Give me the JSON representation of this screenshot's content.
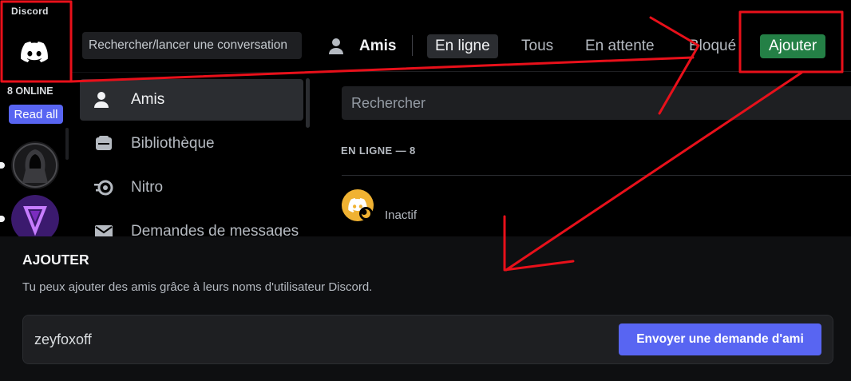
{
  "app": {
    "name": "Discord"
  },
  "rail": {
    "online_label": "8 ONLINE",
    "read_all_label": "Read all"
  },
  "dm": {
    "search_label": "Rechercher/lancer une conversation",
    "items": [
      {
        "label": "Amis",
        "icon": "friends-icon"
      },
      {
        "label": "Bibliothèque",
        "icon": "library-icon"
      },
      {
        "label": "Nitro",
        "icon": "nitro-icon"
      },
      {
        "label": "Demandes de messages",
        "icon": "mail-icon"
      }
    ]
  },
  "topbar": {
    "title": "Amis",
    "tabs": [
      {
        "label": "En ligne",
        "selected": true
      },
      {
        "label": "Tous",
        "selected": false
      },
      {
        "label": "En attente",
        "selected": false
      },
      {
        "label": "Bloqué",
        "selected": false
      }
    ],
    "add_label": "Ajouter"
  },
  "friends": {
    "search_placeholder": "Rechercher",
    "section_label": "EN LIGNE — 8",
    "rows": [
      {
        "status": "Inactif"
      }
    ]
  },
  "add_friend": {
    "title": "AJOUTER",
    "description": "Tu peux ajouter des amis grâce à leurs noms d'utilisateur Discord.",
    "input_value": "zeyfoxoff",
    "send_label": "Envoyer une demande d'ami"
  },
  "colors": {
    "blurple": "#5865f2",
    "green": "#248046",
    "idle": "#f0b232",
    "annotation": "#e8101a"
  }
}
